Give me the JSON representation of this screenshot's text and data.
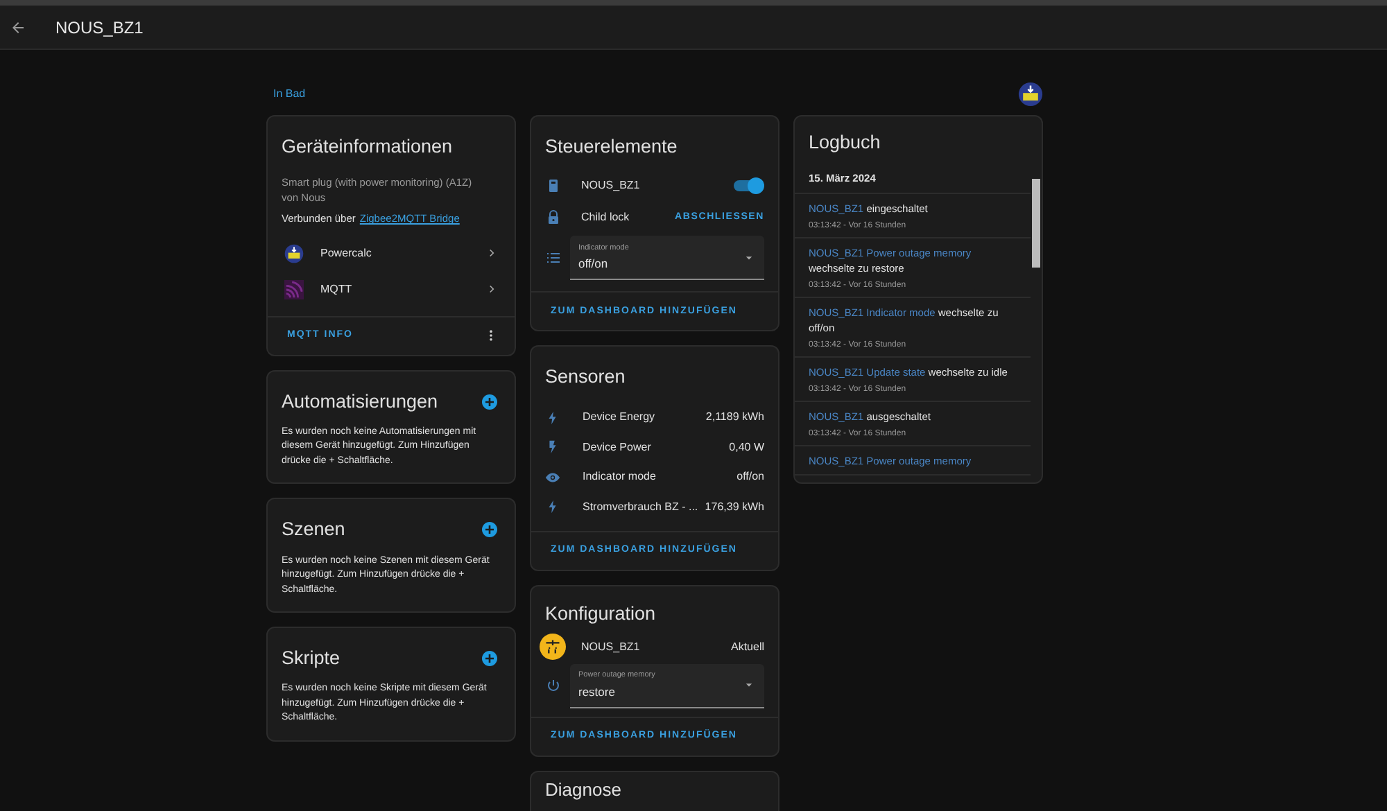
{
  "header": {
    "title": "NOUS_BZ1"
  },
  "area": "In Bad",
  "device_info": {
    "title": "Geräteinformationen",
    "model": "Smart plug (with power monitoring) (A1Z)",
    "manufacturer": "von Nous",
    "connected_prefix": "Verbunden über",
    "connected_link": "Zigbee2MQTT Bridge",
    "integrations": [
      {
        "kind": "powercalc",
        "name": "Powercalc"
      },
      {
        "kind": "mqtt",
        "name": "MQTT"
      }
    ],
    "footer_button": "MQTT INFO"
  },
  "sections": [
    {
      "title": "Automatisierungen",
      "text": "Es wurden noch keine Automatisierungen mit diesem Gerät hinzugefügt. Zum Hinzufügen drücke die + Schaltfläche."
    },
    {
      "title": "Szenen",
      "text": "Es wurden noch keine Szenen mit diesem Gerät hinzugefügt. Zum Hinzufügen drücke die + Schaltfläche."
    },
    {
      "title": "Skripte",
      "text": "Es wurden noch keine Skripte mit diesem Gerät hinzugefügt. Zum Hinzufügen drücke die + Schaltfläche."
    }
  ],
  "controls": {
    "title": "Steuerelemente",
    "items": [
      {
        "kind": "switch",
        "name": "NOUS_BZ1",
        "on": true
      },
      {
        "kind": "lock",
        "name": "Child lock",
        "action": "ABSCHLIESSEN"
      },
      {
        "kind": "select",
        "label": "Indicator mode",
        "value": "off/on"
      }
    ],
    "footer_button": "ZUM DASHBOARD HINZUFÜGEN"
  },
  "sensors": {
    "title": "Sensoren",
    "items": [
      {
        "kind": "energy",
        "name": "Device Energy",
        "value": "2,1189 kWh"
      },
      {
        "kind": "power",
        "name": "Device Power",
        "value": "0,40 W"
      },
      {
        "kind": "mode",
        "name": "Indicator mode",
        "value": "off/on"
      },
      {
        "kind": "energy",
        "name": "Stromverbrauch BZ - ...",
        "value": "176,39 kWh"
      }
    ],
    "footer_button": "ZUM DASHBOARD HINZUFÜGEN"
  },
  "config": {
    "title": "Konfiguration",
    "items": [
      {
        "kind": "update",
        "name": "NOUS_BZ1",
        "status": "Aktuell"
      },
      {
        "kind": "select",
        "label": "Power outage memory",
        "value": "restore"
      }
    ],
    "footer_button": "ZUM DASHBOARD HINZUFÜGEN"
  },
  "diagnose": {
    "title": "Diagnose"
  },
  "logbook": {
    "title": "Logbuch",
    "date": "15. März 2024",
    "entries": [
      {
        "entity": "NOUS_BZ1",
        "action": "eingeschaltet",
        "time": "03:13:42 - Vor 16 Stunden"
      },
      {
        "entity": "NOUS_BZ1 Power outage memory",
        "action": "wechselte zu restore",
        "time": "03:13:42 - Vor 16 Stunden"
      },
      {
        "entity": "NOUS_BZ1 Indicator mode",
        "action": "wechselte zu off/on",
        "time": "03:13:42 - Vor 16 Stunden"
      },
      {
        "entity": "NOUS_BZ1 Update state",
        "action": "wechselte zu idle",
        "time": "03:13:42 - Vor 16 Stunden"
      },
      {
        "entity": "NOUS_BZ1",
        "action": "ausgeschaltet",
        "time": "03:13:42 - Vor 16 Stunden"
      },
      {
        "entity": "NOUS_BZ1 Power outage memory"
      }
    ]
  }
}
